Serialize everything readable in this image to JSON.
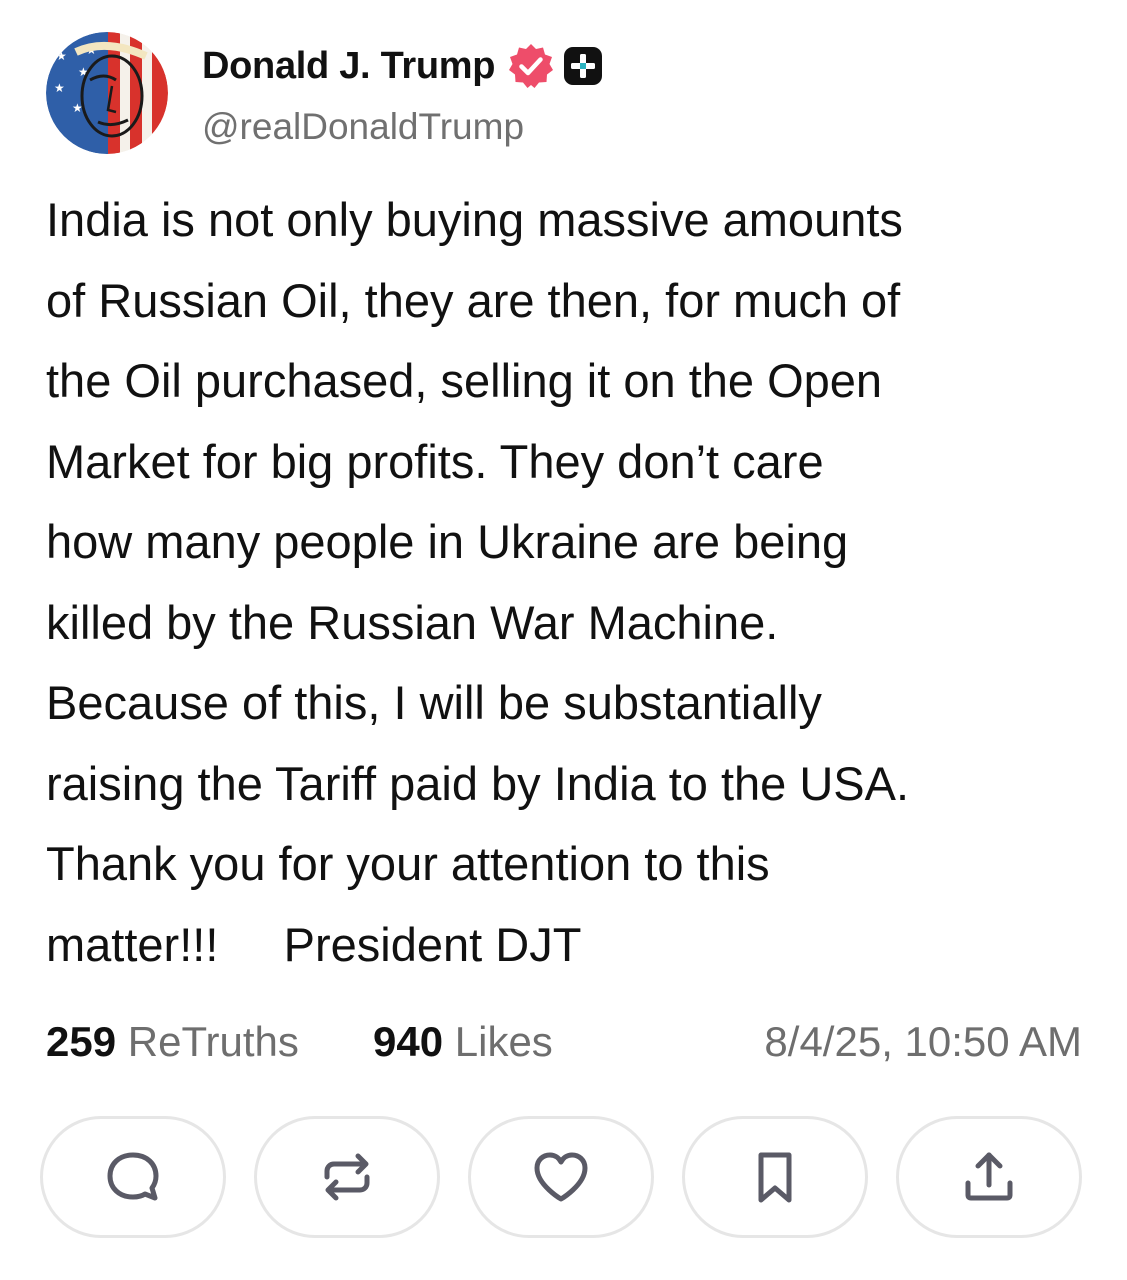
{
  "author": {
    "display_name": "Donald J. Trump",
    "handle": "@realDonaldTrump",
    "verified_badge_color": "#ee4d6a",
    "plus_badge_color": "#111111"
  },
  "post": {
    "text": "India is not only buying massive amounts\nof Russian Oil, they are then, for much of\nthe Oil purchased, selling it on the Open\nMarket for big profits. They don’t care\nhow many people in Ukraine are being\nkilled by the Russian War Machine.\nBecause of this, I will be substantially\nraising the Tariff paid by India to the USA.\nThank you for your attention to this\nmatter!!!     President DJT"
  },
  "stats": {
    "retruths_count": "259",
    "retruths_label": "ReTruths",
    "likes_count": "940",
    "likes_label": "Likes",
    "timestamp": "8/4/25, 10:50 AM"
  },
  "actions": [
    {
      "icon": "reply-icon"
    },
    {
      "icon": "retruth-icon"
    },
    {
      "icon": "like-icon"
    },
    {
      "icon": "bookmark-icon"
    },
    {
      "icon": "share-icon"
    }
  ]
}
